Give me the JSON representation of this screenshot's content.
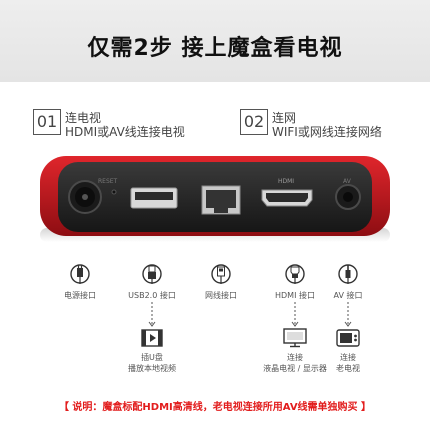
{
  "header": {
    "title": "仅需2步  接上魔盒看电视"
  },
  "steps": [
    {
      "num": "01",
      "title": "连电视",
      "desc": "HDMI或AV线连接电视"
    },
    {
      "num": "02",
      "title": "连网",
      "desc": "WIFI或网线连接网络"
    }
  ],
  "device": {
    "port_marks": [
      "RESET",
      "HDMI",
      "AV"
    ]
  },
  "ports": [
    {
      "icon": "power-plug-icon",
      "label": "电源接口"
    },
    {
      "icon": "usb-plug-icon",
      "label": "USB2.0 接口"
    },
    {
      "icon": "ethernet-plug-icon",
      "label": "网线接口"
    },
    {
      "icon": "hdmi-plug-icon",
      "label": "HDMI 接口"
    },
    {
      "icon": "av-plug-icon",
      "label": "AV 接口"
    }
  ],
  "uses": [
    {
      "icon": "video-file-icon",
      "line1": "插U盘",
      "line2": "播放本地视频"
    },
    {
      "icon": "lcd-tv-icon",
      "line1": "连接",
      "line2": "液晶电视 / 显示器"
    },
    {
      "icon": "old-tv-icon",
      "line1": "连接",
      "line2": "老电视"
    }
  ],
  "note": "【 说明：魔盒标配HDMI高清线，老电视连接所用AV线需单独购买 】",
  "colors": {
    "accent_red": "#e21c1c",
    "device_red": "#c8161d",
    "device_black": "#222222"
  }
}
